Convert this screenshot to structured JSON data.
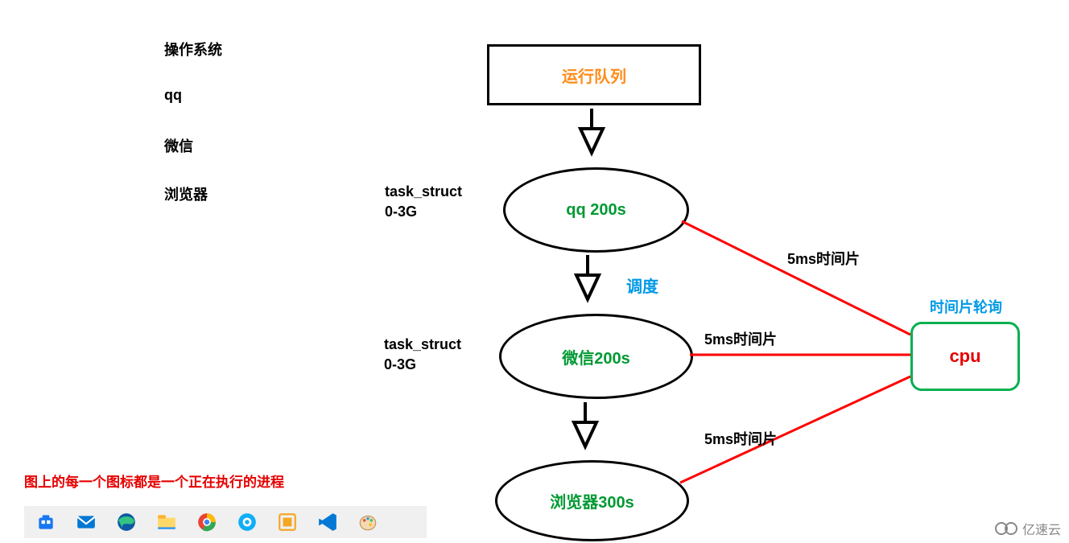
{
  "left_list": {
    "title": "操作系统",
    "items": [
      "qq",
      "微信",
      "浏览器"
    ]
  },
  "caption_red": "图上的每一个图标都是一个正在执行的进程",
  "diagram": {
    "run_queue": "运行队列",
    "task_struct_label_1_line1": "task_struct",
    "task_struct_label_1_line2": "0-3G",
    "task_struct_label_2_line1": "task_struct",
    "task_struct_label_2_line2": "0-3G",
    "node_qq": "qq 200s",
    "node_wechat": "微信200s",
    "node_browser": "浏览器300s",
    "sched_label": "调度",
    "edge_label_1": "5ms时间片",
    "edge_label_2": "5ms时间片",
    "edge_label_3": "5ms时间片",
    "cpu_title": "时间片轮询",
    "cpu_label": "cpu"
  },
  "watermark": "亿速云",
  "taskbar_icons": [
    "store-icon",
    "mail-icon",
    "edge-icon",
    "explorer-icon",
    "chrome-icon",
    "browser-icon",
    "vm-icon",
    "vscode-icon",
    "paint-icon"
  ]
}
